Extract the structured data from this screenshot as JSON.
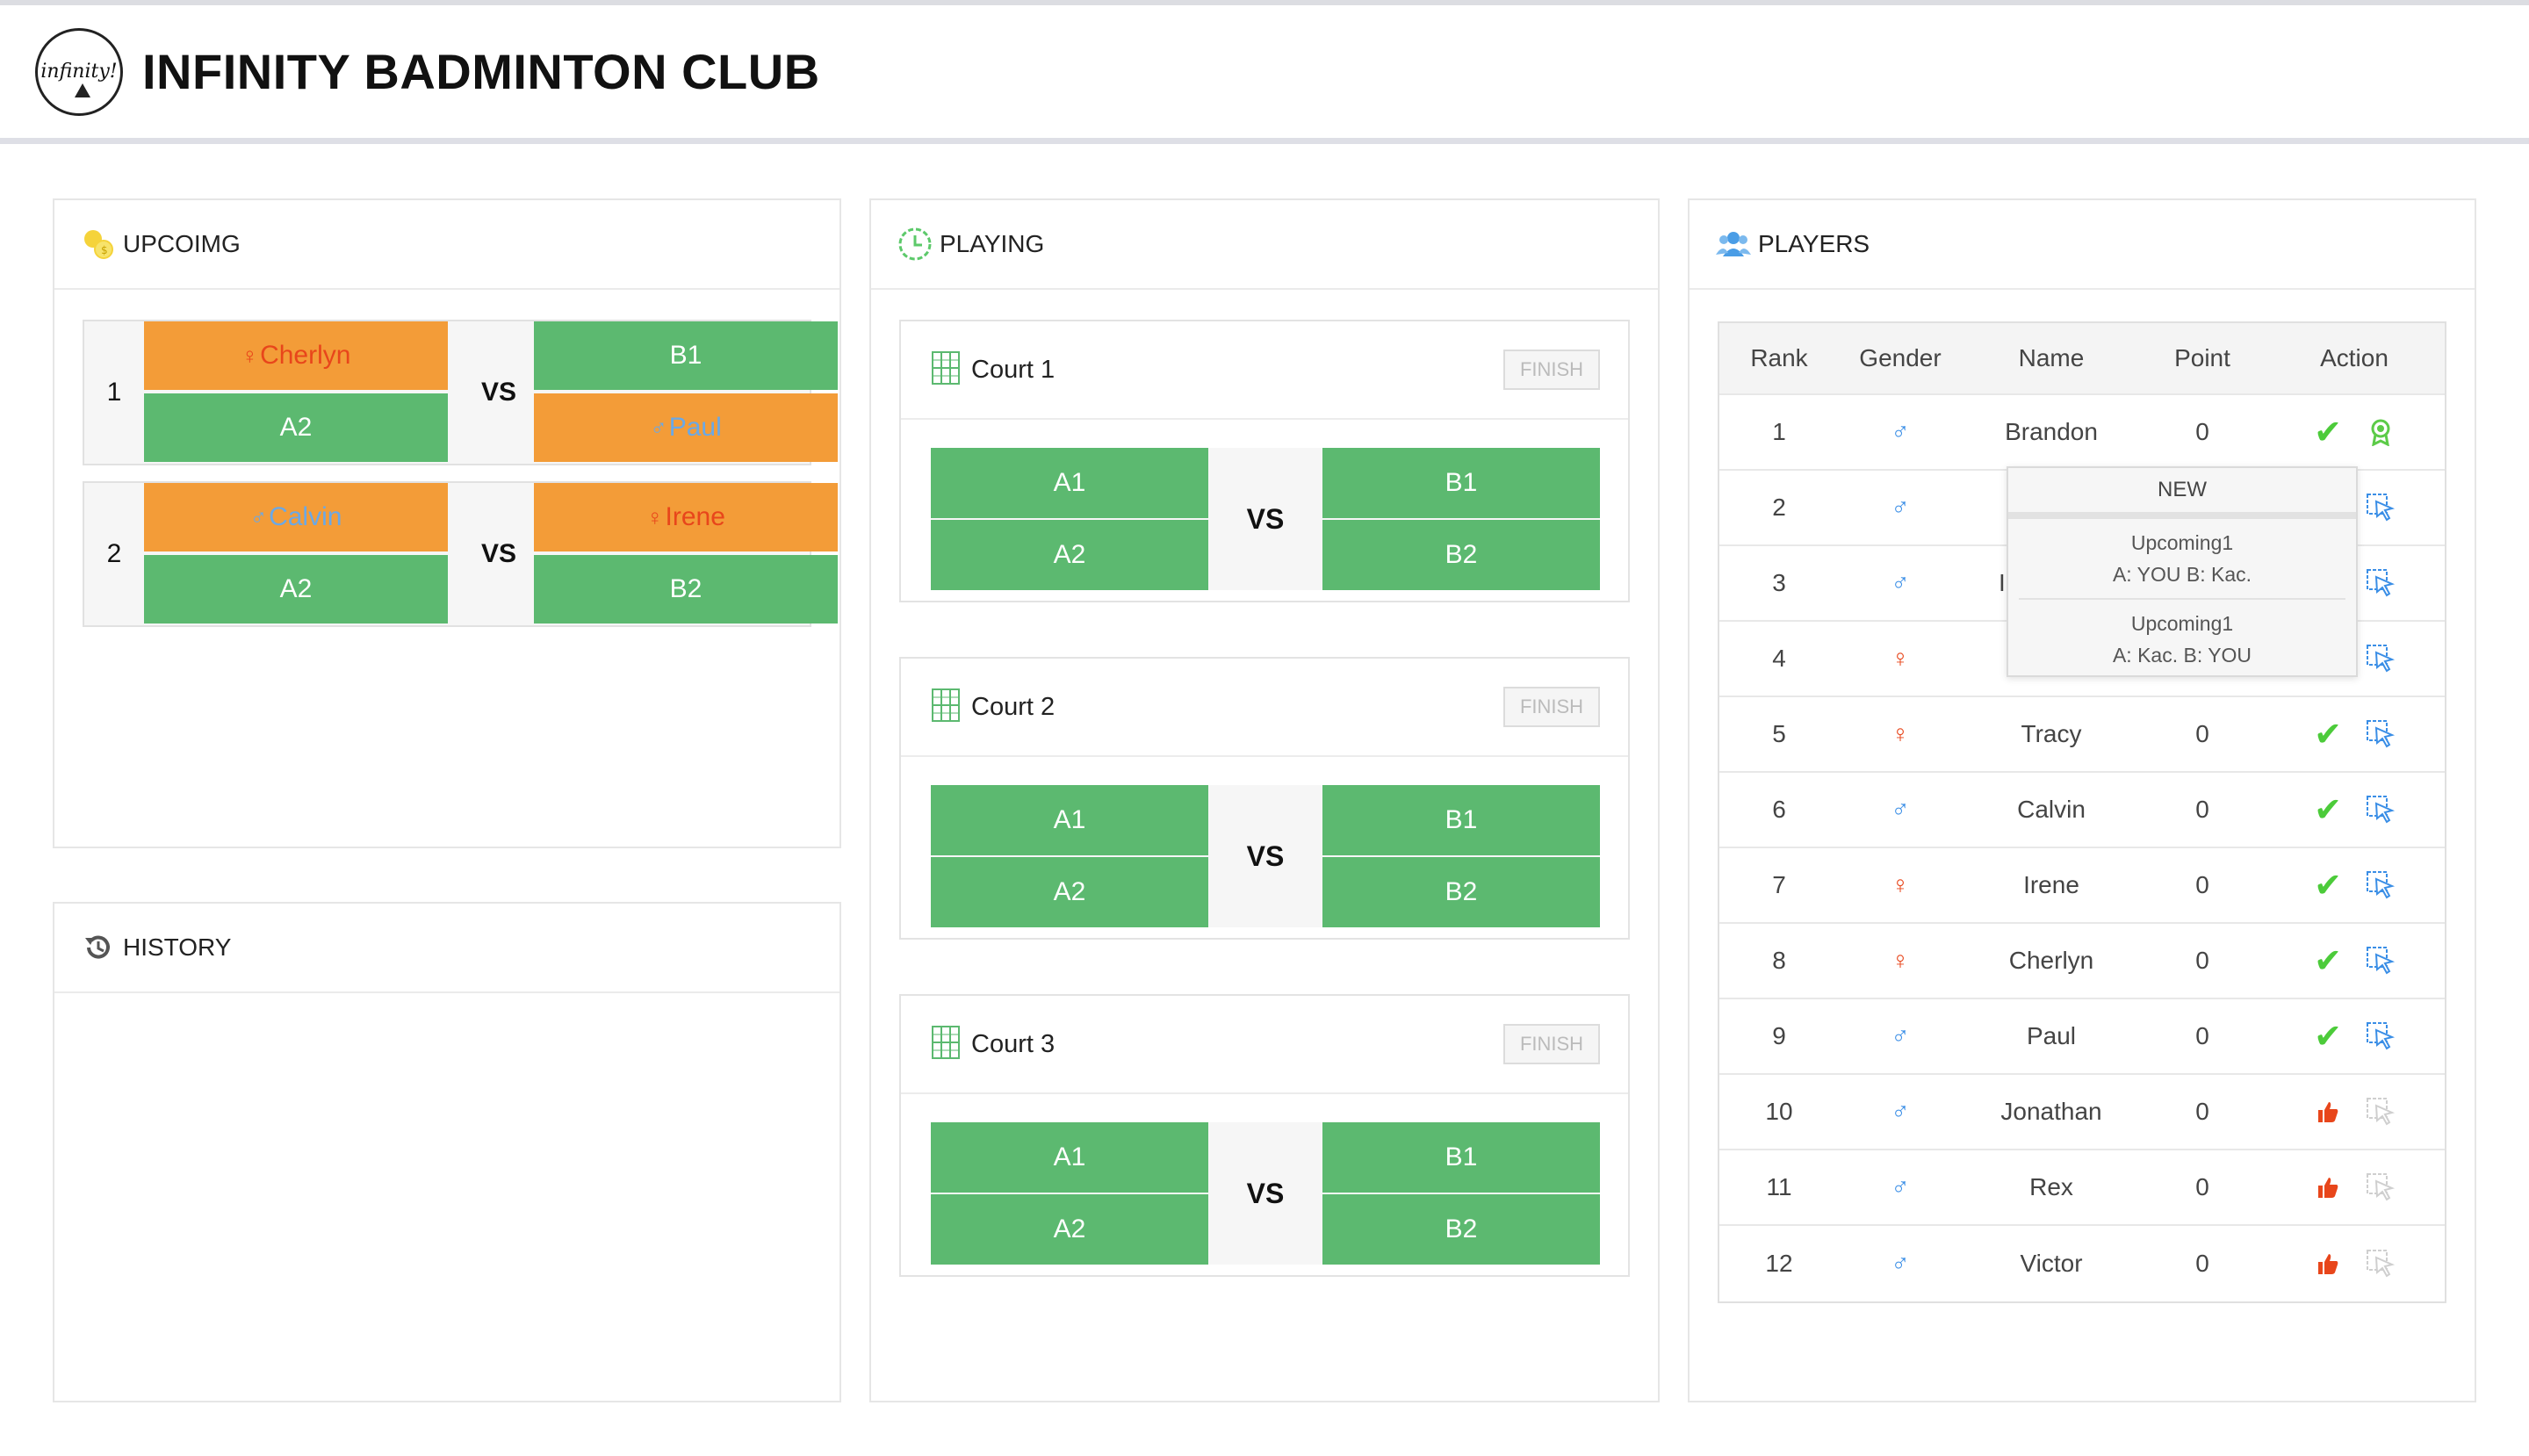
{
  "app": {
    "title": "INFINITY BADMINTON CLUB",
    "logo_text": "infinity!"
  },
  "upcoming": {
    "title": "UPCOIMG",
    "vs_label": "VS",
    "matches": [
      {
        "num": "1",
        "a1": "Cherlyn",
        "a2": "A2",
        "b1": "B1",
        "b2": "Paul"
      },
      {
        "num": "2",
        "a1": "Calvin",
        "a2": "A2",
        "b1": "Irene",
        "b2": "B2"
      }
    ]
  },
  "history": {
    "title": "HISTORY"
  },
  "playing": {
    "title": "PLAYING",
    "vs_label": "VS",
    "finish_label": "FINISH",
    "courts": [
      {
        "name": "Court 1",
        "a1": "A1",
        "a2": "A2",
        "b1": "B1",
        "b2": "B2"
      },
      {
        "name": "Court 2",
        "a1": "A1",
        "a2": "A2",
        "b1": "B1",
        "b2": "B2"
      },
      {
        "name": "Court 3",
        "a1": "A1",
        "a2": "A2",
        "b1": "B1",
        "b2": "B2"
      }
    ]
  },
  "players": {
    "title": "PLAYERS",
    "columns": [
      "Rank",
      "Gender",
      "Name",
      "Point",
      "Action"
    ],
    "rows": [
      {
        "rank": "1",
        "gender": "male",
        "name": "Brandon",
        "point": "0",
        "status": "check",
        "second": "award"
      },
      {
        "rank": "2",
        "gender": "male",
        "name": "",
        "point": "",
        "status": "",
        "second": "pointer"
      },
      {
        "rank": "3",
        "gender": "male",
        "name": "",
        "point": "",
        "status": "",
        "second": "pointer"
      },
      {
        "rank": "4",
        "gender": "female",
        "name": "",
        "point": "",
        "status": "",
        "second": "pointer"
      },
      {
        "rank": "5",
        "gender": "female",
        "name": "Tracy",
        "point": "0",
        "status": "check",
        "second": "pointer"
      },
      {
        "rank": "6",
        "gender": "male",
        "name": "Calvin",
        "point": "0",
        "status": "check",
        "second": "pointer"
      },
      {
        "rank": "7",
        "gender": "female",
        "name": "Irene",
        "point": "0",
        "status": "check",
        "second": "pointer"
      },
      {
        "rank": "8",
        "gender": "female",
        "name": "Cherlyn",
        "point": "0",
        "status": "check",
        "second": "pointer"
      },
      {
        "rank": "9",
        "gender": "male",
        "name": "Paul",
        "point": "0",
        "status": "check",
        "second": "pointer"
      },
      {
        "rank": "10",
        "gender": "male",
        "name": "Jonathan",
        "point": "0",
        "status": "thumb",
        "second": "pointer-disabled"
      },
      {
        "rank": "11",
        "gender": "male",
        "name": "Rex",
        "point": "0",
        "status": "thumb",
        "second": "pointer-disabled"
      },
      {
        "rank": "12",
        "gender": "male",
        "name": "Victor",
        "point": "0",
        "status": "thumb",
        "second": "pointer-disabled"
      }
    ],
    "partial_name_row3": "I"
  },
  "popup": {
    "header": "NEW",
    "items": [
      {
        "line1": "Upcoming1",
        "line2": "A: YOU B: Kac."
      },
      {
        "line1": "Upcoming1",
        "line2": "A: Kac. B: YOU"
      }
    ]
  },
  "colors": {
    "green": "#5cb970",
    "orange": "#f39c38",
    "female": "#e8461b",
    "male": "#3a8ee6"
  }
}
